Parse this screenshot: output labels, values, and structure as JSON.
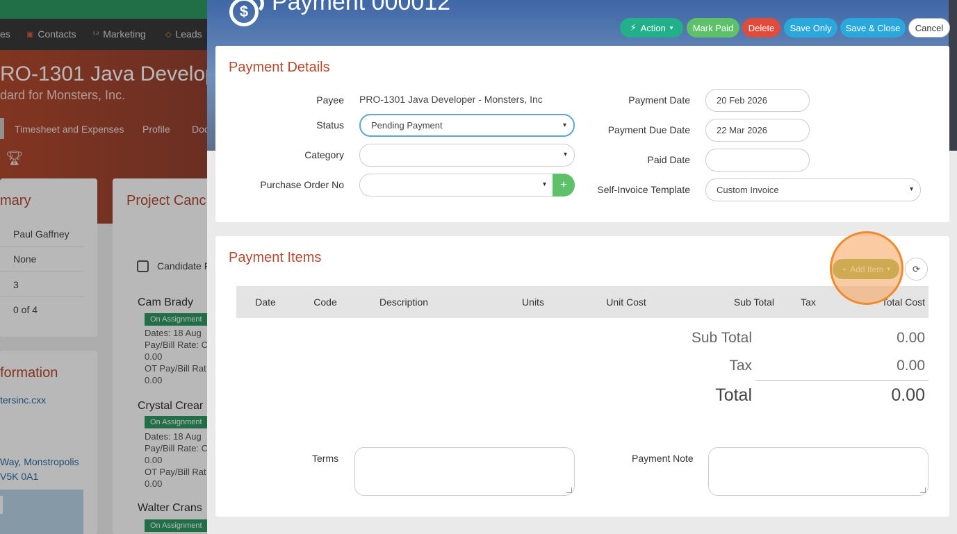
{
  "background": {
    "nav": {
      "items": [
        "es",
        "Contacts",
        "Marketing",
        "Leads"
      ]
    },
    "hero": {
      "title": "RO-1301 Java Develop",
      "subtitle": "dard for Monsters, Inc."
    },
    "subnav": {
      "items": [
        "Timesheet and Expenses",
        "Profile",
        "Doc"
      ]
    },
    "summary": {
      "title": "mary",
      "values": [
        "Paul Gaffney",
        "None",
        "3",
        "0 of 4"
      ]
    },
    "candidates": {
      "title": "Project Canc",
      "select_label": "Candidate F",
      "items": [
        {
          "name": "Cam Brady",
          "badge": "On Assignment",
          "lines": [
            "Dates: 18 Aug",
            "Pay/Bill Rate: C",
            "0.00",
            "OT Pay/Bill Rat",
            "0.00"
          ]
        },
        {
          "name": "Crystal Crear",
          "badge": "On Assignment",
          "lines": [
            "Dates: 18 Aug",
            "Pay/Bill Rate: C",
            "0.00",
            "OT Pay/Bill Rat",
            "0.00"
          ]
        },
        {
          "name": "Walter Crans",
          "badge": "On Assignment"
        }
      ]
    },
    "information": {
      "title": "formation",
      "email": "tersinc.cxx",
      "address1": "Way, Monstropolis",
      "address2": "V5K 0A1"
    }
  },
  "modal": {
    "title": "Payment 000012",
    "buttons": {
      "action": "Action",
      "mark_paid": "Mark Paid",
      "delete": "Delete",
      "save_only": "Save Only",
      "save_close": "Save & Close",
      "cancel": "Cancel"
    },
    "details": {
      "title": "Payment Details",
      "payee_label": "Payee",
      "payee_value": "PRO-1301 Java Developer - Monsters, Inc",
      "status_label": "Status",
      "status_value": "Pending Payment",
      "category_label": "Category",
      "category_value": "",
      "po_label": "Purchase Order No",
      "po_value": "",
      "payment_date_label": "Payment Date",
      "payment_date_value": "20 Feb 2026",
      "due_date_label": "Payment Due Date",
      "due_date_value": "22 Mar 2026",
      "paid_date_label": "Paid Date",
      "paid_date_value": "",
      "template_label": "Self-Invoice Template",
      "template_value": "Custom Invoice"
    },
    "items": {
      "title": "Payment Items",
      "add_item_label": "Add Item",
      "columns": [
        "Date",
        "Code",
        "Description",
        "Units",
        "Unit Cost",
        "Sub Total",
        "Tax",
        "Total Cost"
      ],
      "rows": [],
      "totals": {
        "subtotal_label": "Sub Total",
        "subtotal": "0.00",
        "tax_label": "Tax",
        "tax": "0.00",
        "total_label": "Total",
        "total": "0.00"
      }
    },
    "notes": {
      "terms_label": "Terms",
      "terms_value": "",
      "payment_note_label": "Payment Note",
      "payment_note_value": ""
    }
  },
  "colors": {
    "accent": "#b5492f",
    "green": "#5fc06a",
    "teal": "#21b08a",
    "red": "#e04b3c",
    "blue": "#2aa8dc",
    "highlight": "#f08a2b"
  }
}
